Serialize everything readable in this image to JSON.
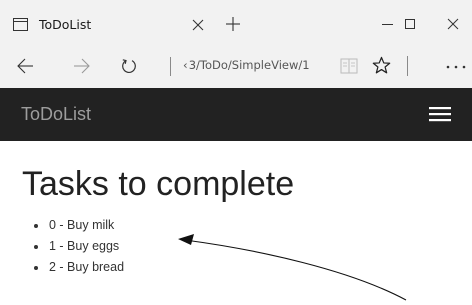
{
  "browser": {
    "tab_title": "ToDoList",
    "address": "‹ 3/ToDo/SimpleView/1",
    "icons": {
      "tab": "window-icon",
      "close": "close-icon",
      "new_tab": "plus-icon",
      "minimize": "minimize-icon",
      "maximize": "maximize-icon",
      "window_close": "close-icon",
      "back": "back-arrow-icon",
      "forward": "forward-arrow-icon",
      "refresh": "refresh-icon",
      "reading_view": "reading-view-icon",
      "favorite": "star-icon",
      "more": "more-icon"
    }
  },
  "app": {
    "brand": "ToDoList",
    "menu_icon": "hamburger-menu-icon",
    "bar_color": "#222222",
    "brand_color": "#9d9d9d"
  },
  "main": {
    "title": "Tasks to complete",
    "tasks": [
      "0 - Buy milk",
      "1 - Buy eggs",
      "2 - Buy bread"
    ]
  }
}
